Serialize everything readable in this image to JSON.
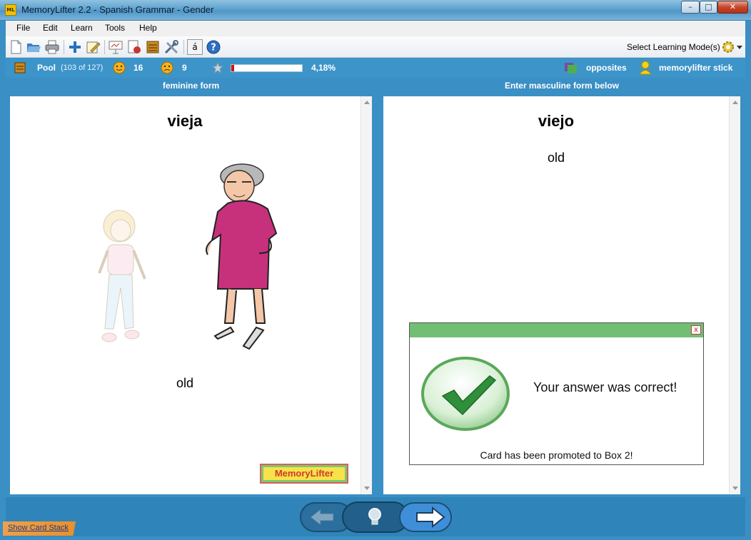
{
  "window": {
    "title": "MemoryLifter 2.2 - Spanish Grammar - Gender",
    "app_icon_text": "ML",
    "minimize_glyph": "–",
    "maximize_glyph": "□",
    "close_glyph": "✕"
  },
  "menu": [
    "File",
    "Edit",
    "Learn",
    "Tools",
    "Help"
  ],
  "toolbar": {
    "buttons": [
      "new-document-icon",
      "open-folder-icon",
      "print-icon",
      "add-card-icon",
      "edit-card-icon",
      "presentation-icon",
      "statistics-icon",
      "card-box-icon",
      "settings-tools-icon",
      "special-character-icon",
      "help-icon"
    ],
    "special_char": "á",
    "learning_mode_label": "Select Learning Mode(s)"
  },
  "status": {
    "box_label": "Pool",
    "pool_count": "(103 of 127)",
    "correct_count": "16",
    "wrong_count": "9",
    "progress_fraction": 0.0418,
    "progress_text": "4,18%",
    "chapter": "opposites",
    "user": "memorylifter stick"
  },
  "question": {
    "title": "feminine form",
    "word": "vieja",
    "translation": "old",
    "logo_text": "MemoryLifter"
  },
  "answer": {
    "title": "Enter masculine form below",
    "word": "viejo",
    "translation": "old"
  },
  "popup": {
    "message": "Your answer was correct!",
    "subtext": "Card has been promoted to Box 2!",
    "close_glyph": "x"
  },
  "bottom": {
    "show_stack": "Show Card Stack"
  },
  "colors": {
    "window_blue": "#3a8fc4",
    "popup_green": "#72bf74",
    "progress_red": "#dd1111"
  }
}
